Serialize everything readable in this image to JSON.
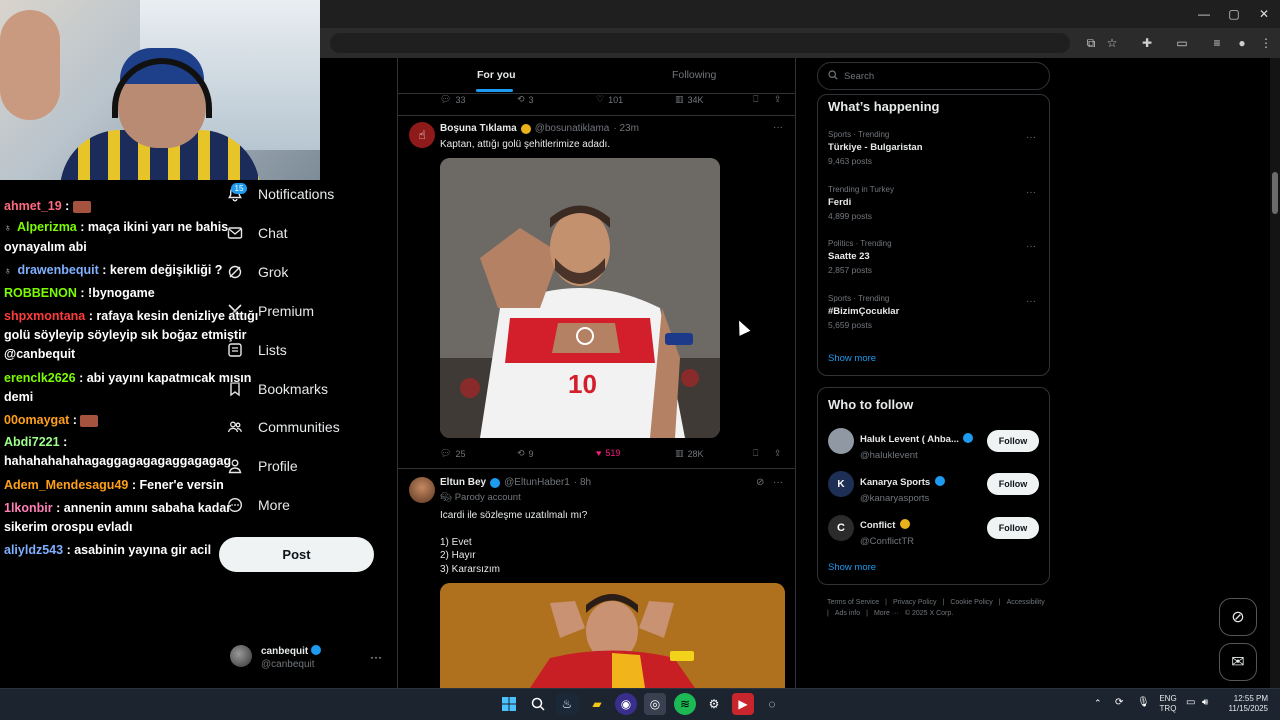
{
  "browser": {
    "window_controls": [
      "—",
      "▢",
      "✕"
    ]
  },
  "chat": [
    {
      "user": "ahmet_19",
      "color": "#ff6b81",
      "message": ":",
      "emote": true
    },
    {
      "user": "Alperizma",
      "color": "#7cfc00",
      "message": ": maça ikini yarı ne bahis oynayalım abi",
      "badge": "♁"
    },
    {
      "user": "drawenbequit",
      "color": "#7fb0ff",
      "message": ": kerem değişikliği ?",
      "badge": "♁"
    },
    {
      "user": "ROBBENON",
      "color": "#7cfc00",
      "message": ": !bynogame"
    },
    {
      "user": "shpxmontana",
      "color": "#ff3b3b",
      "message": ": rafaya kesin denizliye attığı golü söyleyip söyleyip sık boğaz etmiştir @canbequit"
    },
    {
      "user": "erenclk2626",
      "color": "#7cfc00",
      "message": ": abi yayını kapatmıcak mısın demi"
    },
    {
      "user": "00omaygat",
      "color": "#ff9f1a",
      "message": ":",
      "emote": true
    },
    {
      "user": "Abdi7221",
      "color": "#9dff8a",
      "message": ": hahahahahahagaggagagagaggagagag"
    },
    {
      "user": "Adem_Mendesagu49",
      "color": "#ff9f1a",
      "message": ": Fener'e versin"
    },
    {
      "user": "1lkonbir",
      "color": "#ff7eb6",
      "message": ": annenin amını sabaha kadar sikerim orospu evladı"
    },
    {
      "user": "aliyldz543",
      "color": "#7fb0ff",
      "message": ": asabinin yayına gir acil"
    }
  ],
  "nav": {
    "notifications_count": "15",
    "items": [
      {
        "label": "Notifications",
        "icon": "bell"
      },
      {
        "label": "Chat",
        "icon": "envelope"
      },
      {
        "label": "Grok",
        "icon": "grok"
      },
      {
        "label": "Premium",
        "icon": "x-logo"
      },
      {
        "label": "Lists",
        "icon": "list"
      },
      {
        "label": "Bookmarks",
        "icon": "bookmark"
      },
      {
        "label": "Communities",
        "icon": "people"
      },
      {
        "label": "Profile",
        "icon": "person"
      },
      {
        "label": "More",
        "icon": "more-circle"
      }
    ],
    "post_label": "Post",
    "account": {
      "name": "canbequit",
      "handle": "@canbequit",
      "more": "···"
    }
  },
  "feed": {
    "tabs": {
      "active": "For you",
      "inactive": "Following"
    },
    "prev_metrics": {
      "replies": "33",
      "reposts": "3",
      "likes": "101",
      "views": "34K"
    },
    "tweets": [
      {
        "name": "Boşuna Tıklama",
        "handle": "@bosunatiklama",
        "time": "· 23m",
        "text": "Kaptan, attığı golü şehitlerimize adadı.",
        "metrics": {
          "replies": "25",
          "reposts": "9",
          "likes": "519",
          "views": "28K"
        },
        "verified_color": "#e8b21b"
      },
      {
        "name": "Eltun Bey",
        "handle": "@EltunHaber1",
        "time": "· 8h",
        "label": "Parody account",
        "text_lines": [
          "Icardi ile sözleşme uzatılmalı mı?",
          "",
          "1) Evet",
          "2) Hayır",
          "3) Kararsızım"
        ],
        "verified_color": "#1d9bf0"
      }
    ],
    "jersey_number": "10"
  },
  "sidebar": {
    "search_placeholder": "Search",
    "happening_title": "What’s happening",
    "trends": [
      {
        "category": "Sports · Trending",
        "name": "Türkiye - Bulgaristan",
        "posts": "9,463 posts"
      },
      {
        "category": "Trending in Turkey",
        "name": "Ferdi",
        "posts": "4,899 posts"
      },
      {
        "category": "Politics · Trending",
        "name": "Saatte 23",
        "posts": "2,857 posts"
      },
      {
        "category": "Sports · Trending",
        "name": "#BizimÇocuklar",
        "posts": "5,659 posts"
      }
    ],
    "show_more": "Show more",
    "wtf_title": "Who to follow",
    "follow_label": "Follow",
    "suggestions": [
      {
        "name": "Haluk Levent ( Ahba...",
        "handle": "@haluklevent",
        "verified_color": "#1d9bf0",
        "avatar_color": "#8f98a3"
      },
      {
        "name": "Kanarya Sports",
        "handle": "@kanaryasports",
        "verified_color": "#1d9bf0",
        "avatar_color": "#1e2f55"
      },
      {
        "name": "Conflict",
        "handle": "@ConflictTR",
        "verified_color": "#e8b21b",
        "avatar_color": "#2b2b2b"
      }
    ],
    "footer": [
      "Terms of Service",
      "|",
      "Privacy Policy",
      "|",
      "Cookie Policy",
      "|",
      "Accessibility",
      "|",
      "Ads info",
      "|",
      "More ···",
      "© 2025 X Corp."
    ]
  },
  "taskbar": {
    "lang": "ENG",
    "lang2": "TRQ",
    "time": "12:55 PM",
    "date": "11/15/2025"
  },
  "colors": {
    "accent": "#1d9bf0",
    "like": "#f91880",
    "background": "#000000"
  }
}
